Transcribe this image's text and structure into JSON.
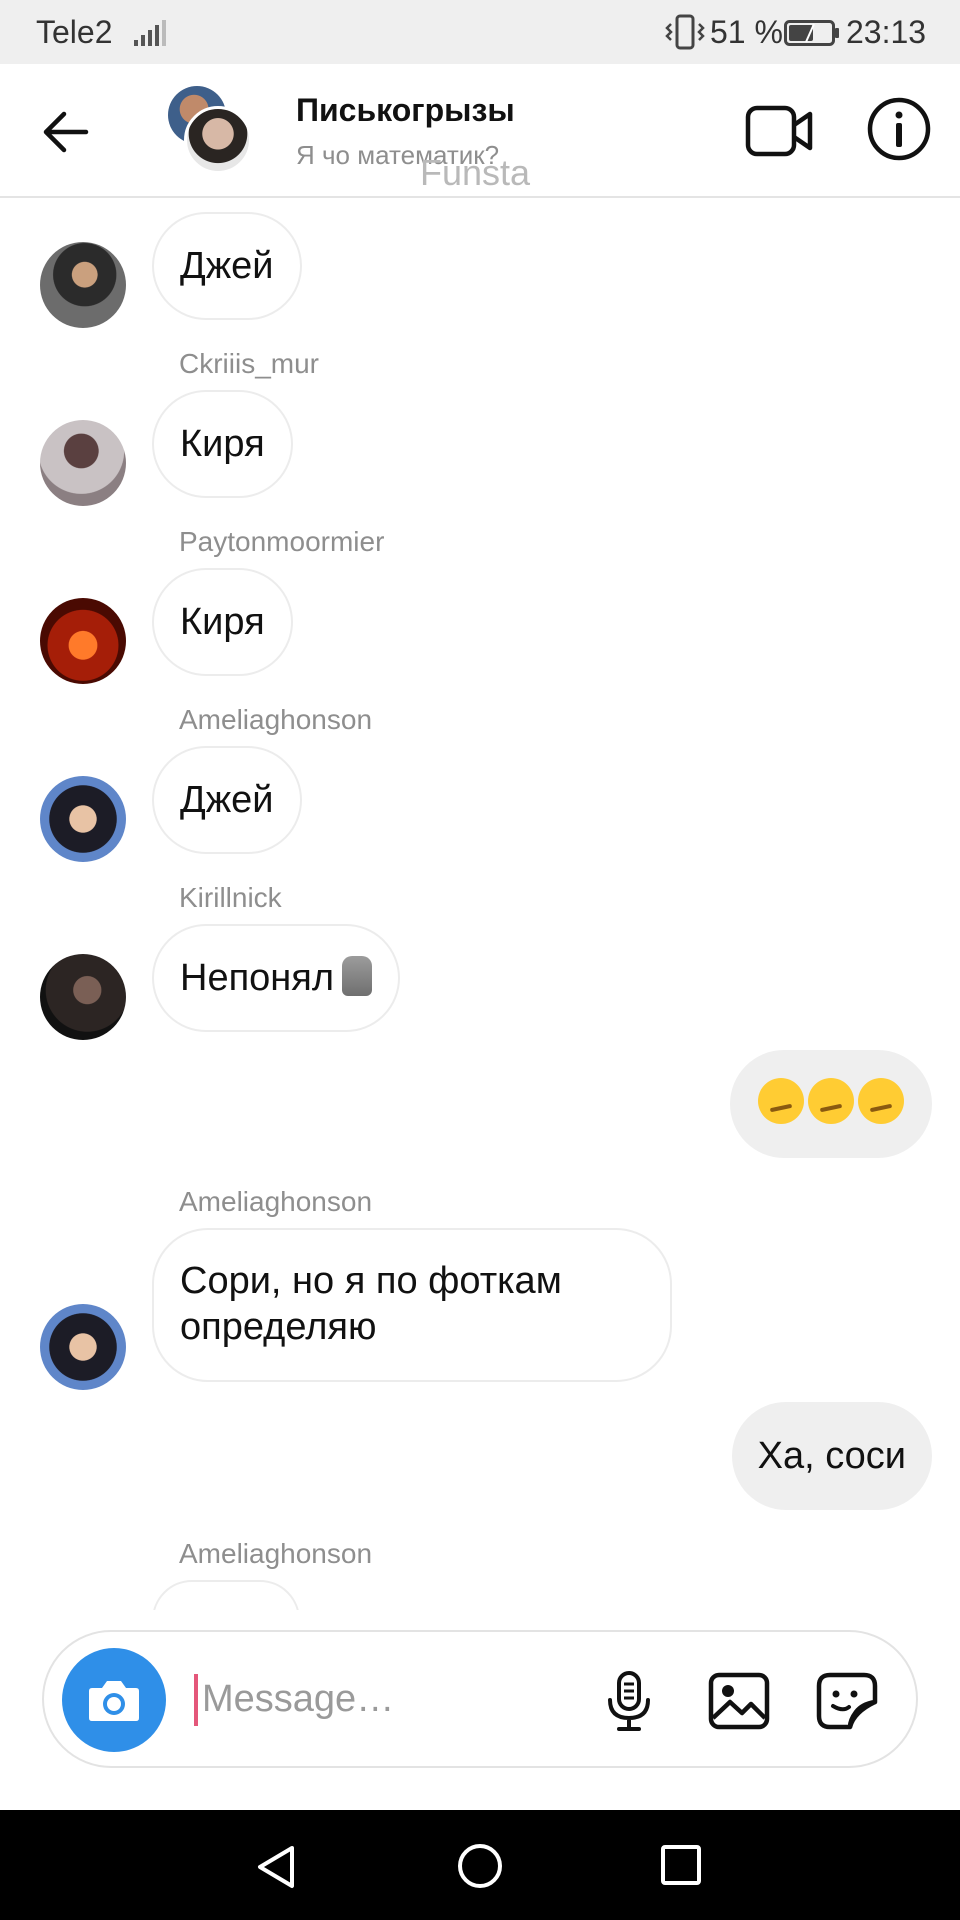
{
  "status_bar": {
    "carrier": "Tele2",
    "battery_percent": "51 %",
    "time": "23:13"
  },
  "header": {
    "title": "Писькогрызы",
    "subtitle": "Я чо математик?",
    "watermark": "Funsta"
  },
  "messages": [
    {
      "sender": "",
      "text": "Джей",
      "direction": "in"
    },
    {
      "sender": "Ckriiis_mur",
      "text": "Киря",
      "direction": "in"
    },
    {
      "sender": "Paytonmoormier",
      "text": "Киря",
      "direction": "in"
    },
    {
      "sender": "Ameliaghonson",
      "text": "Джей",
      "direction": "in"
    },
    {
      "sender": "Kirillnick",
      "text": "Непонял",
      "direction": "in"
    },
    {
      "sender": "",
      "text": "",
      "direction": "out",
      "emoji": "smirking-face x3"
    },
    {
      "sender": "Ameliaghonson",
      "text": "Сори, но я по фоткам определяю",
      "direction": "in"
    },
    {
      "sender": "",
      "text": "Ха, соси",
      "direction": "out"
    },
    {
      "sender": "Ameliaghonson",
      "text": "",
      "direction": "in"
    }
  ],
  "composer": {
    "placeholder": "Message…"
  },
  "icons": {
    "back": "back-arrow-icon",
    "video": "video-camera-icon",
    "info": "info-icon",
    "camera": "camera-icon",
    "mic": "microphone-icon",
    "gallery": "image-icon",
    "sticker": "sticker-icon"
  },
  "colors": {
    "accent": "#2f8fe8",
    "caret": "#e4577a",
    "outgoing_bubble": "#efefef"
  }
}
